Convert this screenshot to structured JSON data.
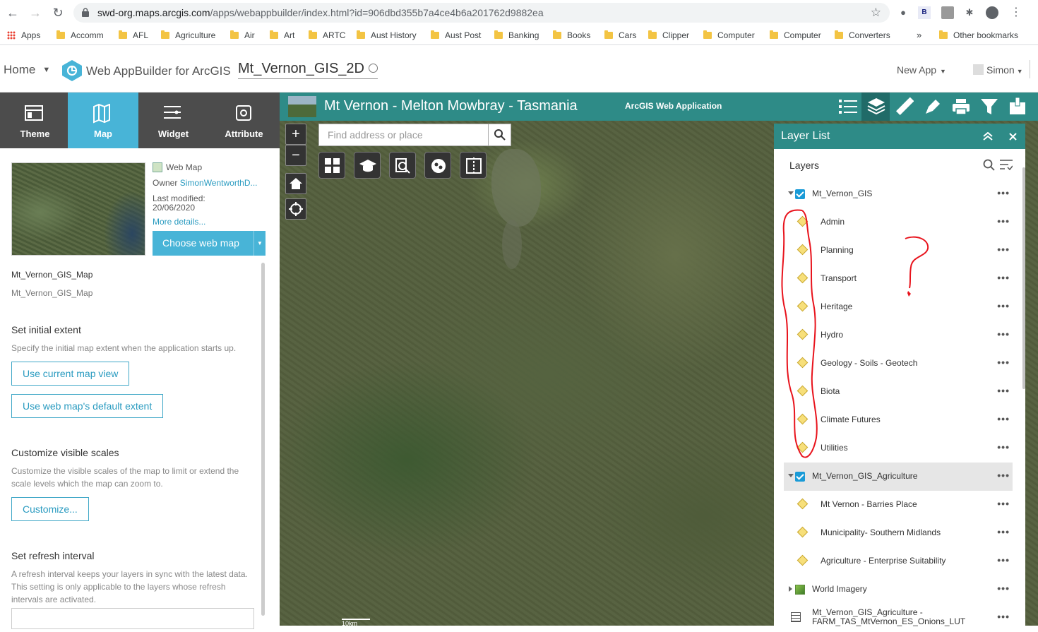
{
  "browser": {
    "url_domain": "swd-org.maps.arcgis.com",
    "url_path": "/apps/webappbuilder/index.html?id=906dbd355b7a4ce4b6a201762d9882ea",
    "bookmarks": [
      "Apps",
      "Accomm",
      "AFL",
      "Agriculture",
      "Air",
      "Art",
      "ARTC",
      "Aust History",
      "Aust Post",
      "Banking",
      "Books",
      "Cars",
      "Clipper",
      "Computer",
      "Computer",
      "Converters"
    ],
    "more": "»",
    "other_bookmarks": "Other bookmarks"
  },
  "wab": {
    "home": "Home",
    "product": "Web AppBuilder for ArcGIS",
    "app_name": "Mt_Vernon_GIS_2D",
    "new_app": "New App",
    "user": "Simon"
  },
  "left_tabs": [
    "Theme",
    "Map",
    "Widget",
    "Attribute"
  ],
  "map_info": {
    "type": "Web Map",
    "owner_label": "Owner",
    "owner_value": "SimonWentworthD...",
    "last_modified_label": "Last modified:",
    "last_modified": "20/06/2020",
    "more_details": "More details...",
    "choose_button": "Choose web map",
    "map_name_1": "Mt_Vernon_GIS_Map",
    "map_name_2": "Mt_Vernon_GIS_Map"
  },
  "settings": {
    "initial_extent_title": "Set initial extent",
    "initial_extent_desc": "Specify the initial map extent when the application starts up.",
    "use_current": "Use current map view",
    "use_default": "Use web map's default extent",
    "scales_title": "Customize visible scales",
    "scales_desc_1": "Customize the visible scales of the map to limit or extend the",
    "scales_desc_2": "scale levels which the map can zoom to.",
    "customize": "Customize...",
    "refresh_title": "Set refresh interval",
    "refresh_desc_1": "A refresh interval keeps your layers in sync with the latest data.",
    "refresh_desc_2": "This setting is only applicable to the layers whose refresh",
    "refresh_desc_3": "intervals are activated."
  },
  "app": {
    "title": "Mt Vernon - Melton Mowbray - Tasmania",
    "subtitle": "ArcGIS Web Application",
    "search_placeholder": "Find address or place",
    "scale_label": "10km"
  },
  "layer_list": {
    "title": "Layer List",
    "layers_label": "Layers",
    "rows": [
      {
        "label": "Mt_Vernon_GIS",
        "kind": "group"
      },
      {
        "label": "Admin",
        "kind": "sub"
      },
      {
        "label": "Planning",
        "kind": "sub"
      },
      {
        "label": "Transport",
        "kind": "sub"
      },
      {
        "label": "Heritage",
        "kind": "sub"
      },
      {
        "label": "Hydro",
        "kind": "sub"
      },
      {
        "label": "Geology - Soils - Geotech",
        "kind": "sub"
      },
      {
        "label": "Biota",
        "kind": "sub"
      },
      {
        "label": "Climate Futures",
        "kind": "sub"
      },
      {
        "label": "Utilities",
        "kind": "sub"
      },
      {
        "label": "Mt_Vernon_GIS_Agriculture",
        "kind": "group"
      },
      {
        "label": "Mt Vernon - Barries Place",
        "kind": "sub"
      },
      {
        "label": "Municipality- Southern Midlands",
        "kind": "sub"
      },
      {
        "label": "Agriculture - Enterprise Suitability",
        "kind": "sub"
      },
      {
        "label": "World Imagery",
        "kind": "imagery"
      },
      {
        "label": "Mt_Vernon_GIS_Agriculture -",
        "label2": "FARM_TAS_MtVernon_ES_Onions_LUT",
        "kind": "table"
      }
    ],
    "more": "•••"
  },
  "colors": {
    "teal": "#2e8b87",
    "tab_active": "#48b4d7",
    "annotation": "#e8131c"
  }
}
